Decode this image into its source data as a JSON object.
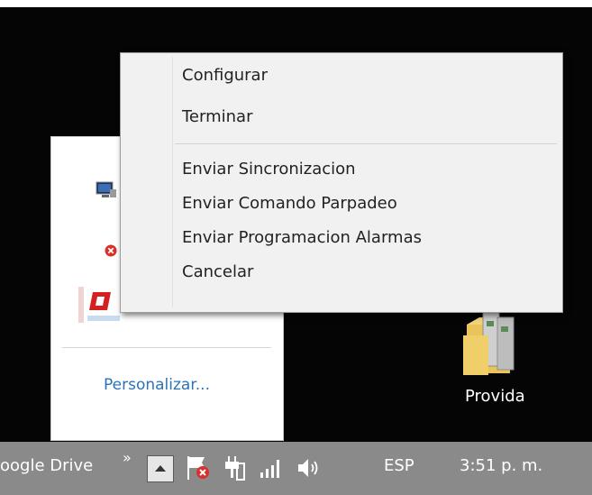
{
  "context_menu": {
    "items": [
      "Configurar",
      "Terminar",
      "Enviar Sincronizacion",
      "Enviar Comando Parpadeo",
      "Enviar Programacion Alarmas",
      "Cancelar"
    ]
  },
  "overflow_panel": {
    "icons": [
      "monitor-network-icon",
      "error-x-icon",
      "red-o-app-icon"
    ],
    "customize_label": "Personalizar..."
  },
  "desktop": {
    "items": [
      {
        "label": "Provida",
        "icon": "folder-icon"
      }
    ]
  },
  "taskbar": {
    "app_label": "oogle Drive",
    "chevron": "»",
    "tray_icons": [
      "show-hidden-icons-button",
      "flag-error-icon",
      "power-plug-icon",
      "signal-bars-icon",
      "volume-icon"
    ],
    "language": "ESP",
    "clock": "3:51 p. m."
  },
  "colors": {
    "desktop_bg": "#050505",
    "taskbar_bg": "#8a8a8a",
    "menu_bg": "#f1f1f1",
    "link": "#2b73b8",
    "error_red": "#d9302c"
  }
}
